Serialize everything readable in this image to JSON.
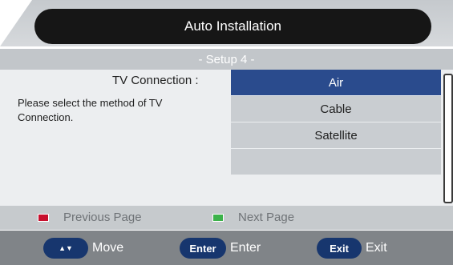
{
  "header": {
    "title": "Auto Installation"
  },
  "step": {
    "label": "- Setup 4 -"
  },
  "content": {
    "connection_label": "TV Connection :",
    "instruction": "Please select the method of TV Connection.",
    "options": [
      {
        "label": "Air",
        "selected": true
      },
      {
        "label": "Cable",
        "selected": false
      },
      {
        "label": "Satellite",
        "selected": false
      },
      {
        "label": "",
        "selected": false
      }
    ]
  },
  "legend": {
    "previous": {
      "label": "Previous Page",
      "color": "#c8102e"
    },
    "next": {
      "label": "Next Page",
      "color": "#3cb24a"
    }
  },
  "nav": {
    "move": {
      "icon": "up-down-arrows-icon",
      "glyph": "▲▼",
      "label": "Move"
    },
    "enter": {
      "button": "Enter",
      "label": "Enter"
    },
    "exit": {
      "button": "Exit",
      "label": "Exit"
    }
  },
  "colors": {
    "selected_bg": "#2a4b8d",
    "nav_button_bg": "#17366e",
    "title_bg": "#161616"
  }
}
